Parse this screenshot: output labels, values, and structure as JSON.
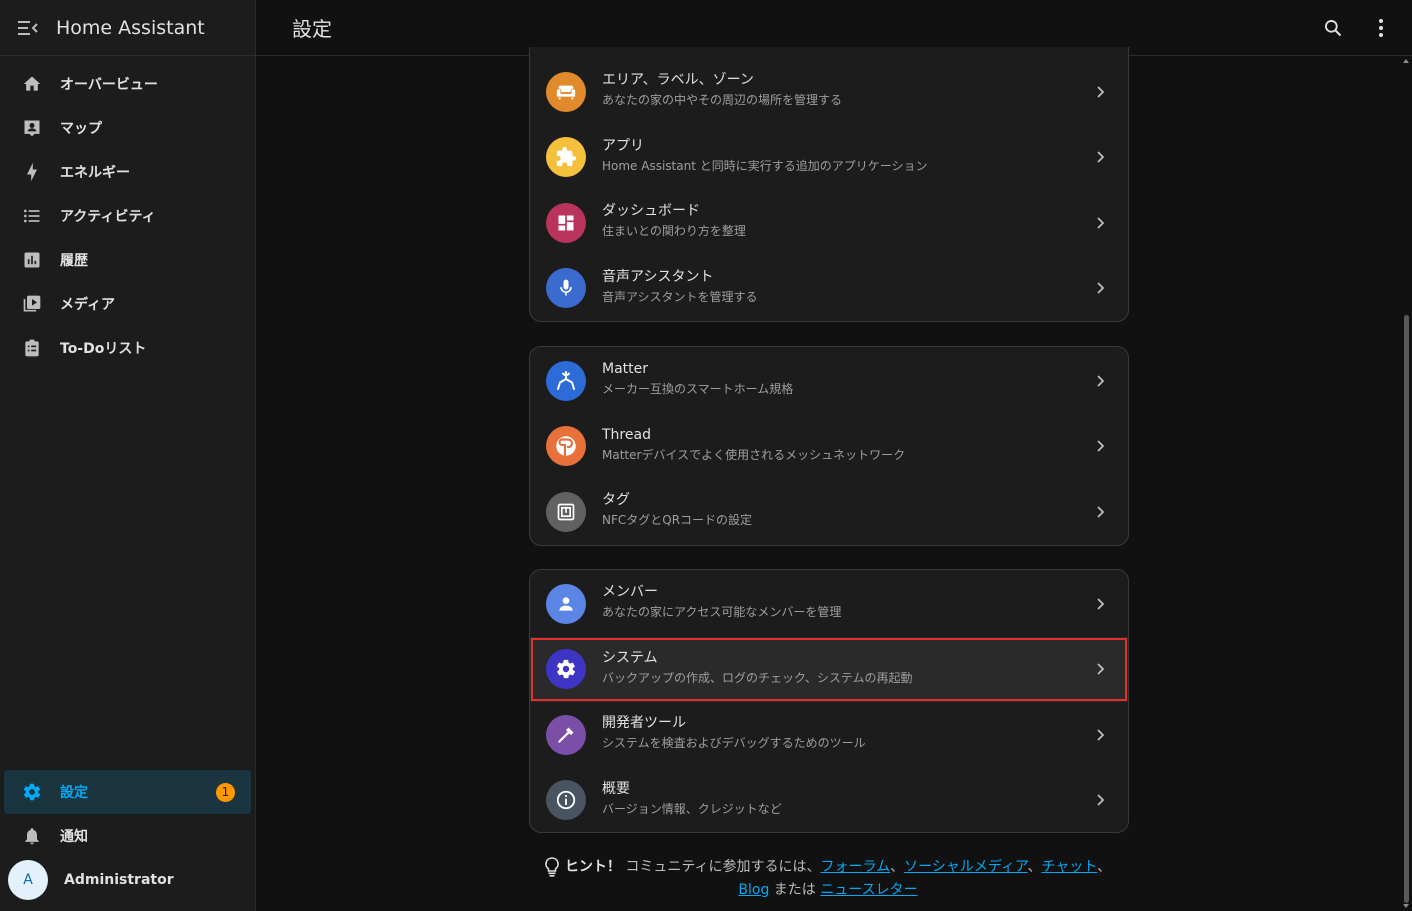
{
  "app": {
    "title": "Home Assistant"
  },
  "header": {
    "title": "設定"
  },
  "sidebar": {
    "items": [
      {
        "label": "オーバービュー",
        "icon": "home-icon"
      },
      {
        "label": "マップ",
        "icon": "map-account-icon"
      },
      {
        "label": "エネルギー",
        "icon": "lightning-bolt-icon"
      },
      {
        "label": "アクティビティ",
        "icon": "format-list-bulleted-icon"
      },
      {
        "label": "履歴",
        "icon": "chart-box-icon"
      },
      {
        "label": "メディア",
        "icon": "play-box-multiple-icon"
      },
      {
        "label": "To-Doリスト",
        "icon": "clipboard-list-icon"
      }
    ],
    "settings": {
      "label": "設定",
      "badge": "1",
      "icon": "cog-icon"
    },
    "notifications": {
      "label": "通知",
      "icon": "bell-icon"
    },
    "user": {
      "initial": "A",
      "name": "Administrator"
    }
  },
  "groups": [
    {
      "items": [
        {
          "title": "エリア、ラベル、ゾーン",
          "subtitle": "あなたの家の中やその周辺の場所を管理する",
          "icon": "sofa-icon",
          "color": "#e08a2c"
        },
        {
          "title": "アプリ",
          "subtitle": "Home Assistant と同時に実行する追加のアプリケーション",
          "icon": "puzzle-icon",
          "color": "#f5c03b"
        },
        {
          "title": "ダッシュボード",
          "subtitle": "住まいとの関わり方を整理",
          "icon": "view-dashboard-icon",
          "color": "#b9335d"
        },
        {
          "title": "音声アシスタント",
          "subtitle": "音声アシスタントを管理する",
          "icon": "microphone-icon",
          "color": "#3b6bd0"
        }
      ]
    },
    {
      "items": [
        {
          "title": "Matter",
          "subtitle": "メーカー互換のスマートホーム規格",
          "icon": "matter-icon",
          "color": "#2d6bd6"
        },
        {
          "title": "Thread",
          "subtitle": "Matterデバイスでよく使用されるメッシュネットワーク",
          "icon": "thread-icon",
          "color": "#e8703a"
        },
        {
          "title": "タグ",
          "subtitle": "NFCタグとQRコードの設定",
          "icon": "nfc-tag-icon",
          "color": "#616161"
        }
      ]
    },
    {
      "items": [
        {
          "title": "メンバー",
          "subtitle": "あなたの家にアクセス可能なメンバーを管理",
          "icon": "account-icon",
          "color": "#5b86e6"
        },
        {
          "title": "システム",
          "subtitle": "バックアップの作成、ログのチェック、システムの再起動",
          "icon": "cog-icon",
          "color": "#3f35c4"
        },
        {
          "title": "開発者ツール",
          "subtitle": "システムを検査およびデバッグするためのツール",
          "icon": "hammer-icon",
          "color": "#7b4ea8"
        },
        {
          "title": "概要",
          "subtitle": "バージョン情報、クレジットなど",
          "icon": "information-icon",
          "color": "#485560"
        }
      ]
    }
  ],
  "hint": {
    "strong": "ヒント！",
    "text1": "コミュニティに参加するには、",
    "link_forum": "フォーラム",
    "sep1": "、",
    "link_social": "ソーシャルメディア",
    "sep2": "、",
    "link_chat": "チャット",
    "sep3": "、",
    "link_blog": "Blog",
    "text2": " または ",
    "link_newsletter": "ニュースレター"
  },
  "colors": {
    "accent": "#03a9f4",
    "badge": "#ff9800",
    "highlight_outline": "#e0312b"
  }
}
